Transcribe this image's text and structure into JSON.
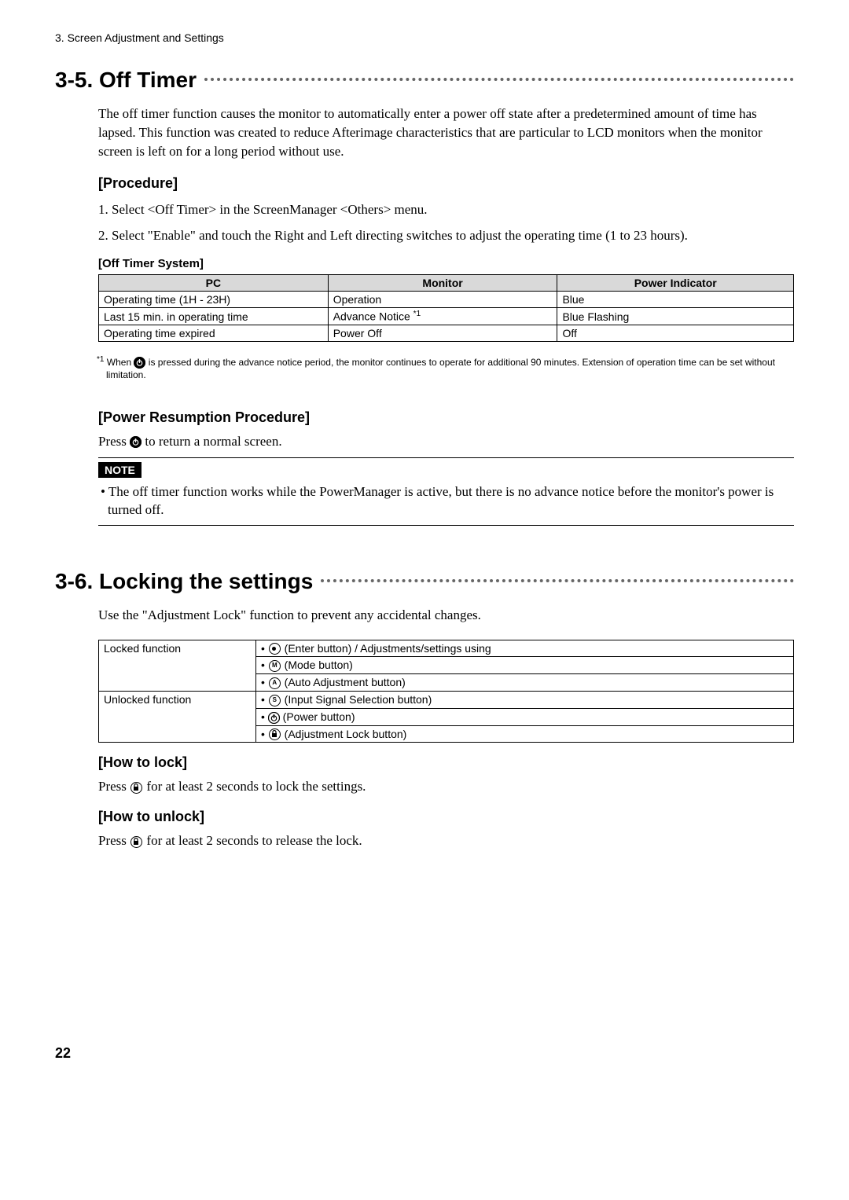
{
  "chapterLabel": "3. Screen Adjustment and Settings",
  "section35": {
    "heading": "3‑5. Off Timer",
    "intro": "The off timer function causes the monitor to automatically enter a power off state after a predetermined amount of time has lapsed. This function was created to reduce Afterimage characteristics that are particular to LCD monitors when the monitor screen is left on for a long period without use.",
    "procedureHeading": "[Procedure]",
    "step1": "1. Select <Off Timer> in the ScreenManager <Others> menu.",
    "step2": "2. Select \"Enable\" and touch the Right and Left directing switches to adjust the operating time (1 to 23 hours).",
    "offTimerSystemHeading": "[Off Timer System]",
    "table": {
      "headers": {
        "pc": "PC",
        "monitor": "Monitor",
        "power_indicator": "Power Indicator"
      },
      "rows": [
        {
          "pc": "Operating time (1H - 23H)",
          "monitor": "Operation",
          "indicator": "Blue"
        },
        {
          "pc": "Last 15 min. in operating time",
          "monitor": "Advance Notice ",
          "monitor_sup": "*1",
          "indicator": "Blue Flashing"
        },
        {
          "pc": "Operating time expired",
          "monitor": "Power Off",
          "indicator": "Off"
        }
      ]
    },
    "footnote_sup": "*1",
    "footnote_pre": " When ",
    "footnote_post": " is pressed during the advance notice period, the monitor continues to operate for additional 90 minutes. Extension of operation time can be set without limitation.",
    "powerResumeHeading": "[Power Resumption Procedure]",
    "powerResume_pre": "Press ",
    "powerResume_post": " to return a normal screen.",
    "noteLabel": "NOTE",
    "noteText": "• The off timer function works while the PowerManager is active, but there is no advance notice before the monitor's power is turned off."
  },
  "section36": {
    "heading": "3‑6. Locking the settings",
    "intro": "Use the \"Adjustment Lock\" function to prevent any accidental changes.",
    "lockedLabel": "Locked function",
    "unlockedLabel": "Unlocked function",
    "locked1_pre": "• ",
    "locked1_post": " (Enter button) / Adjustments/settings using",
    "locked2_pre": "• ",
    "locked2_post": " (Mode button)",
    "locked3_pre": "• ",
    "locked3_post": " (Auto Adjustment button)",
    "unlocked1_pre": "• ",
    "unlocked1_post": " (Input Signal Selection button)",
    "unlocked2_pre": "• ",
    "unlocked2_post": " (Power button)",
    "unlocked3_pre": "• ",
    "unlocked3_post": " (Adjustment Lock button)",
    "howToLockHeading": "[How to lock]",
    "howToLock_pre": "Press ",
    "howToLock_post": " for at least 2 seconds to lock the settings.",
    "howToUnlockHeading": "[How to unlock]",
    "howToUnlock_pre": "Press ",
    "howToUnlock_post": " for at least 2 seconds to release the lock."
  },
  "pageNumber": "22"
}
